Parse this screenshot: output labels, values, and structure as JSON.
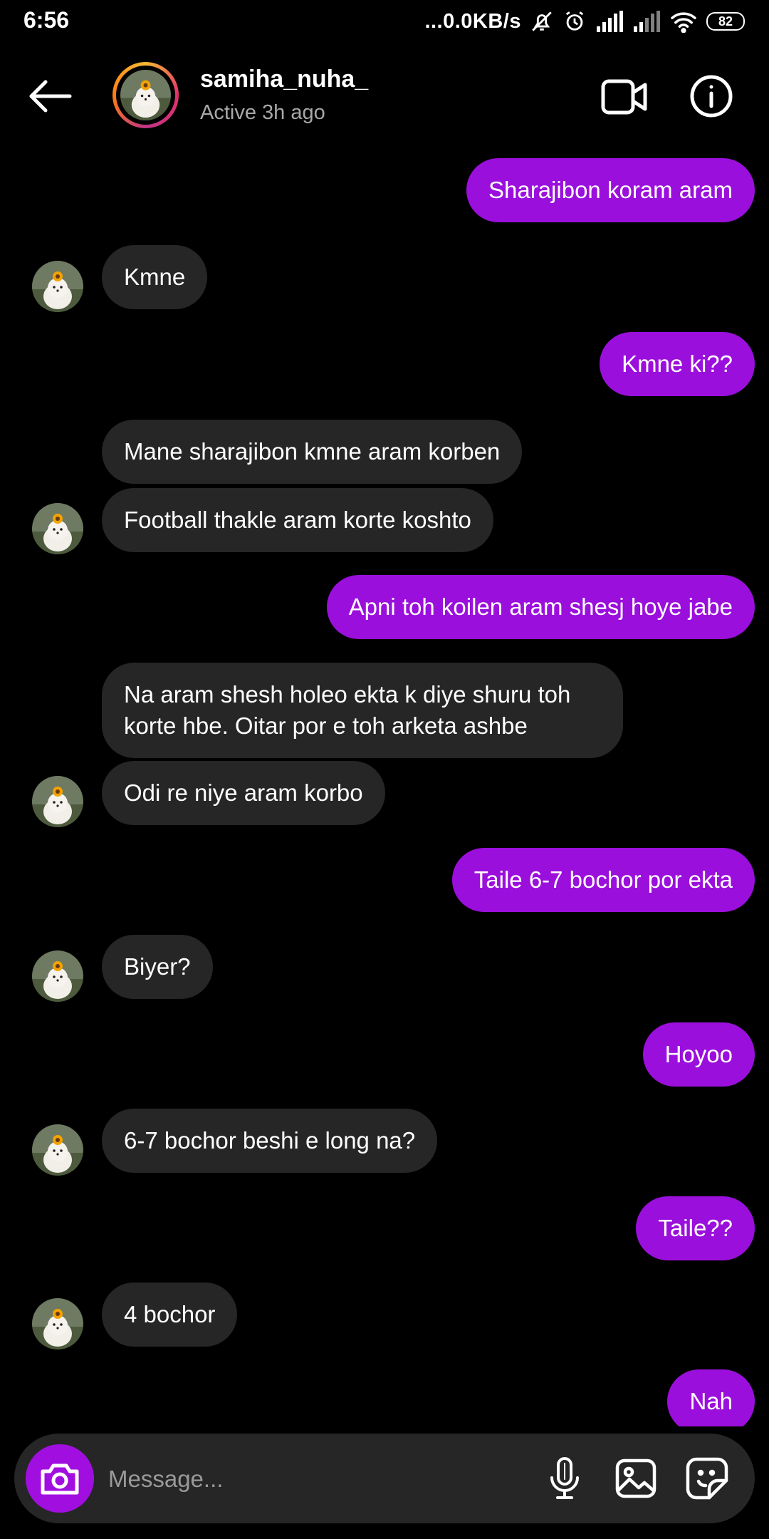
{
  "status_bar": {
    "time": "6:56",
    "network_speed": "...0.0KB/s",
    "battery": "82",
    "icons": [
      "mute-icon",
      "alarm-icon",
      "signal-icon",
      "signal-icon",
      "wifi-icon",
      "battery-icon"
    ]
  },
  "header": {
    "username": "samiha_nuha_",
    "status": "Active 3h ago",
    "icons": [
      "back-arrow-icon",
      "video-call-icon",
      "info-icon"
    ]
  },
  "messages": [
    {
      "dir": "out",
      "text": "Sharajibon koram aram"
    },
    {
      "dir": "in",
      "text": "Kmne"
    },
    {
      "dir": "out",
      "text": "Kmne ki??"
    },
    {
      "dir": "in",
      "text": "Mane sharajibon kmne aram korben"
    },
    {
      "dir": "in",
      "text": "Football thakle aram korte koshto"
    },
    {
      "dir": "out",
      "text": "Apni toh koilen aram shesj hoye jabe"
    },
    {
      "dir": "in",
      "text": "Na aram shesh holeo ekta k diye shuru toh korte hbe. Oitar por e toh arketa ashbe"
    },
    {
      "dir": "in",
      "text": "Odi re niye aram korbo"
    },
    {
      "dir": "out",
      "text": "Taile 6-7 bochor por ekta"
    },
    {
      "dir": "in",
      "text": "Biyer?"
    },
    {
      "dir": "out",
      "text": "Hoyoo"
    },
    {
      "dir": "in",
      "text": "6-7 bochor beshi e long na?"
    },
    {
      "dir": "out",
      "text": "Taile??"
    },
    {
      "dir": "in",
      "text": "4 bochor"
    },
    {
      "dir": "out",
      "text": "Nah"
    }
  ],
  "composer": {
    "placeholder": "Message...",
    "icons": [
      "camera-icon",
      "microphone-icon",
      "gallery-icon",
      "sticker-icon"
    ]
  },
  "colors": {
    "outgoing_bubble": "#9b0fdc",
    "incoming_bubble": "#262626",
    "background": "#000000"
  }
}
